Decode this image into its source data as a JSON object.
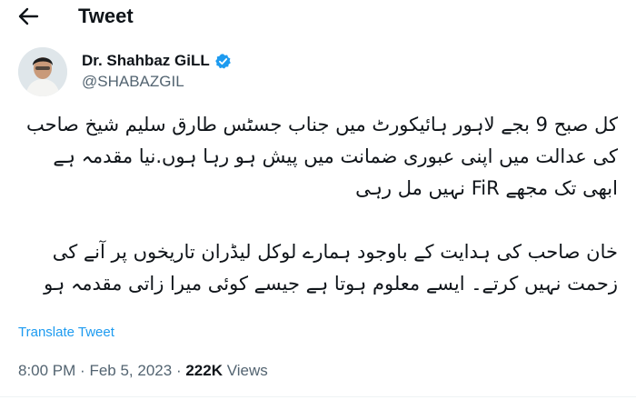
{
  "header": {
    "title": "Tweet",
    "back_icon": "arrow-left-icon"
  },
  "author": {
    "name": "Dr. Shahbaz GiLL",
    "handle": "@SHABAZGIL",
    "verified_icon": "verified-badge-icon",
    "verified_color": "#1d9bf0"
  },
  "tweet": {
    "paragraph1": "کل صبح 9 بجے لاہور ہائیکورٹ میں جناب جسٹس طارق سلیم شیخ صاحب کی عدالت میں اپنی عبوری ضمانت میں پیش ہو رہا ہوں.نیا مقدمہ ہے ابھی تک مجھے FiR نہیں مل رہی",
    "paragraph2": "خان صاحب کی ہدایت کے باوجود ہمارے لوکل لیڈران تاریخوں پر آنے کی زحمت نہیں کرتے۔ ایسے معلوم ہوتا ہے جیسے کوئی میرا زاتی مقدمہ ہو",
    "translate_label": "Translate Tweet"
  },
  "meta": {
    "time": "8:00 PM",
    "separator": "·",
    "date": "Feb 5, 2023",
    "views_count": "222K",
    "views_label": "Views"
  },
  "colors": {
    "link": "#1d9bf0",
    "secondary_text": "#536471",
    "primary_text": "#0f1419"
  }
}
